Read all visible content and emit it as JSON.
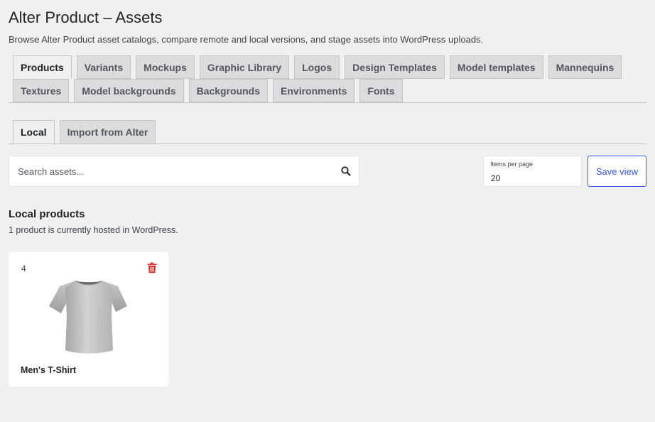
{
  "header": {
    "title": "Alter Product – Assets",
    "description": "Browse Alter Product asset catalogs, compare remote and local versions, and stage assets into WordPress uploads."
  },
  "tabs": [
    {
      "label": "Products",
      "active": true
    },
    {
      "label": "Variants"
    },
    {
      "label": "Mockups"
    },
    {
      "label": "Graphic Library"
    },
    {
      "label": "Logos"
    },
    {
      "label": "Design Templates"
    },
    {
      "label": "Model templates"
    },
    {
      "label": "Mannequins"
    },
    {
      "label": "Textures"
    },
    {
      "label": "Model backgrounds"
    },
    {
      "label": "Backgrounds"
    },
    {
      "label": "Environments"
    },
    {
      "label": "Fonts"
    }
  ],
  "subtabs": [
    {
      "label": "Local",
      "active": true
    },
    {
      "label": "Import from Alter"
    }
  ],
  "toolbar": {
    "search_placeholder": "Search assets...",
    "search_icon": "search-icon",
    "items_per_page_label": "Items per page",
    "items_per_page_value": "20",
    "save_label": "Save view"
  },
  "section": {
    "title": "Local products",
    "subtitle": "1 product is currently hosted in WordPress."
  },
  "products": [
    {
      "id": "4",
      "name": "Men's T-Shirt",
      "delete_icon": "trash-icon"
    }
  ],
  "colors": {
    "accent": "#3858e9",
    "danger": "#d63638",
    "background": "#f0f0f1"
  }
}
